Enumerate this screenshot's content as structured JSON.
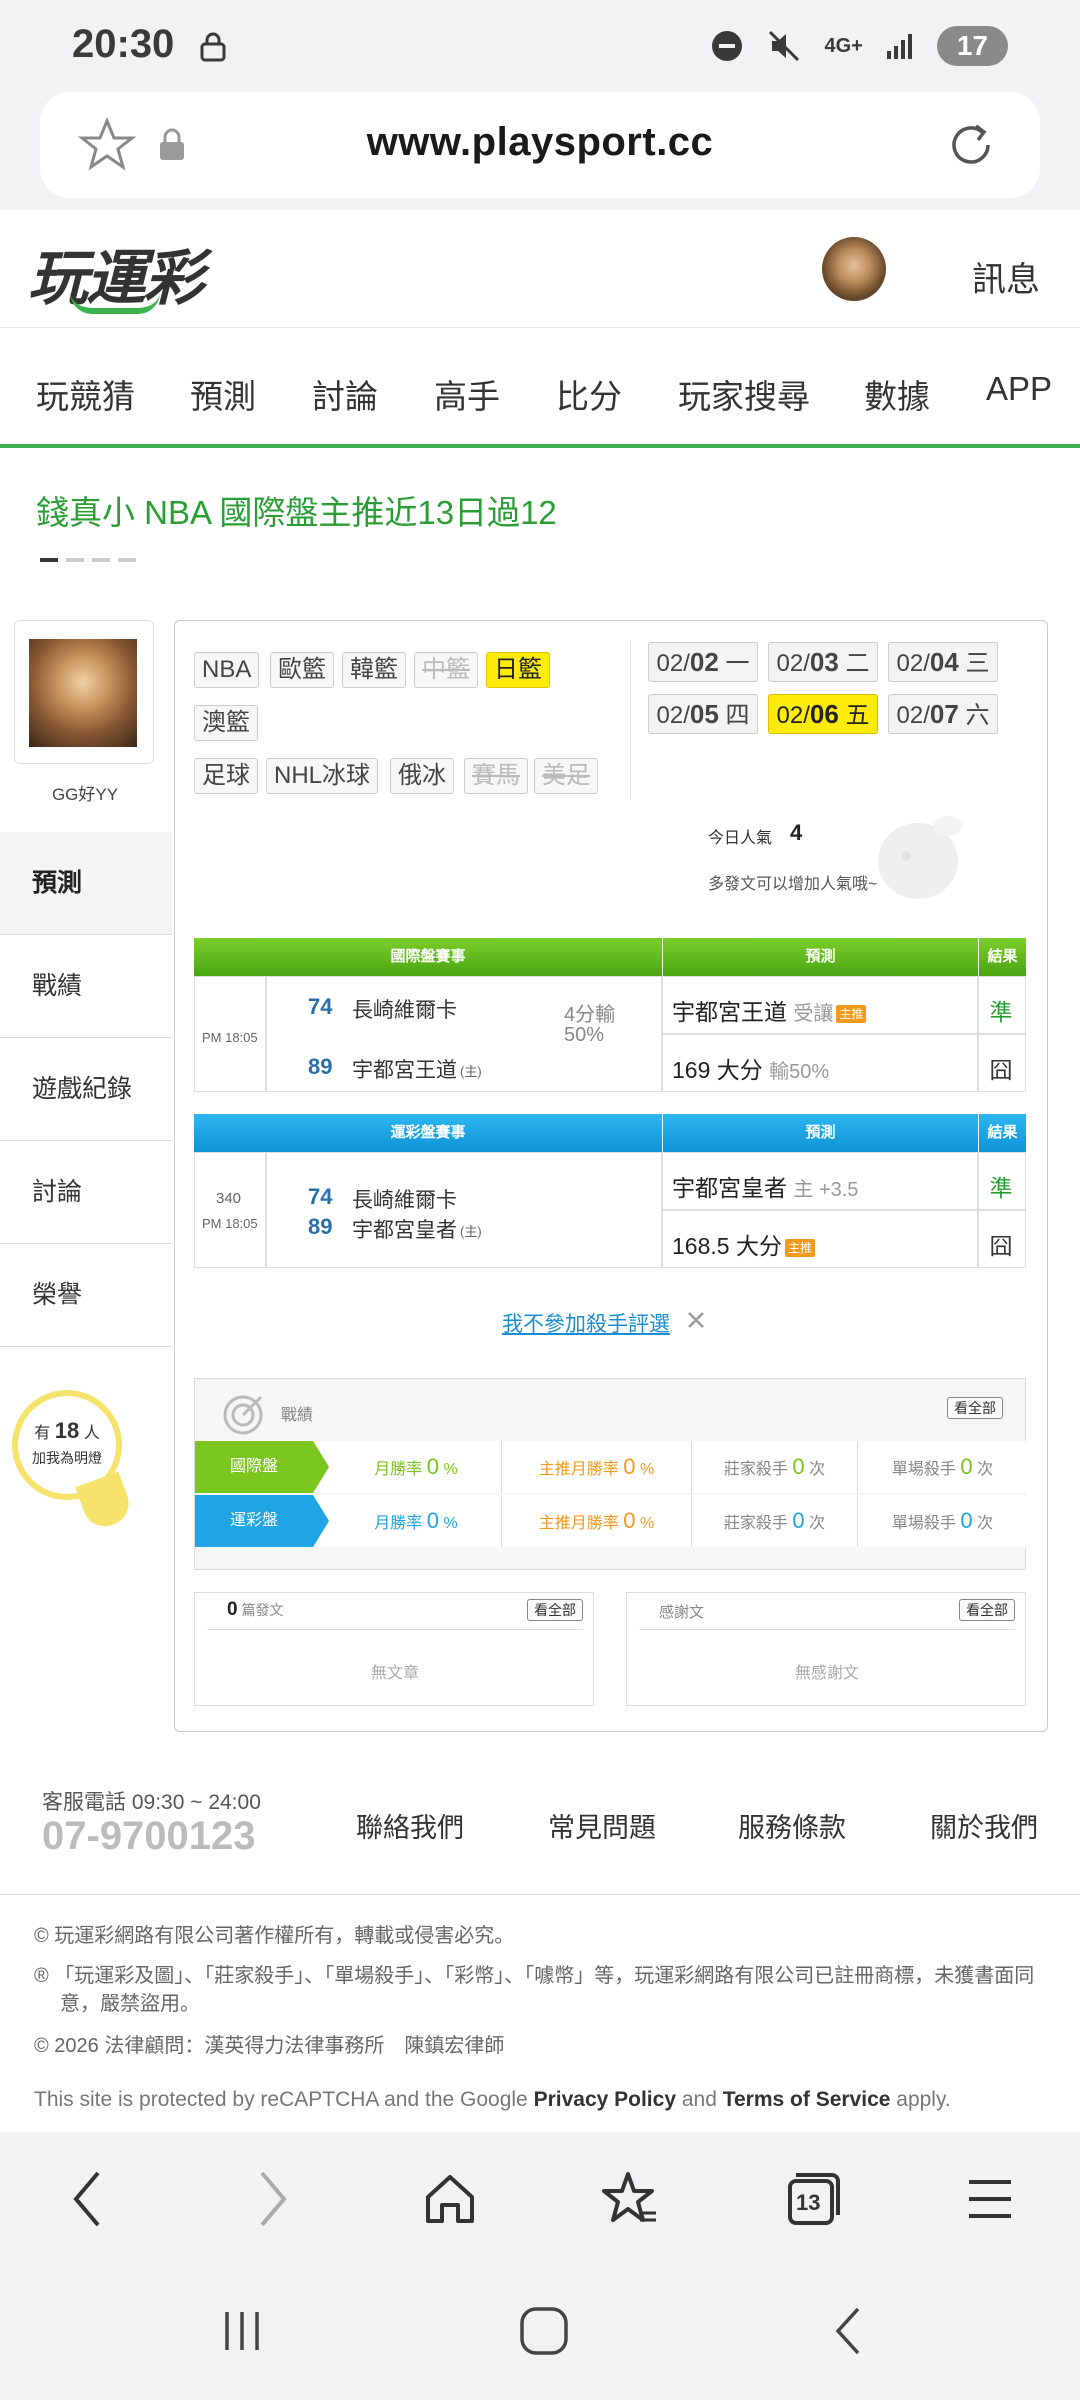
{
  "status_bar": {
    "time": "20:30",
    "network": "4G+",
    "battery": "17"
  },
  "browser": {
    "url": "www.playsport.cc",
    "tabs_count": "13"
  },
  "site": {
    "logo": "玩運彩",
    "messages_label": "訊息"
  },
  "nav": [
    "玩競猜",
    "預測",
    "討論",
    "高手",
    "比分",
    "玩家搜尋",
    "數據",
    "APP"
  ],
  "headline": "錢真小 NBA 國際盤主推近13日過12",
  "profile": {
    "name": "GG好YY"
  },
  "sidebar": [
    "預測",
    "戰績",
    "遊戲紀錄",
    "討論",
    "榮譽"
  ],
  "fans": {
    "prefix": "有",
    "count": "18",
    "suffix": "人",
    "line2": "加我為明燈"
  },
  "league_tags_row1": [
    "NBA",
    "歐籃",
    "韓籃",
    "中籃",
    "日籃"
  ],
  "league_tags_row2": [
    "澳籃"
  ],
  "league_tags_row3": [
    "足球",
    "NHL冰球",
    "俄冰",
    "賽馬",
    "美足"
  ],
  "dates": [
    {
      "md": "02/",
      "d": "02",
      "w": "一"
    },
    {
      "md": "02/",
      "d": "03",
      "w": "二"
    },
    {
      "md": "02/",
      "d": "04",
      "w": "三"
    },
    {
      "md": "02/",
      "d": "05",
      "w": "四"
    },
    {
      "md": "02/",
      "d": "06",
      "w": "五"
    },
    {
      "md": "02/",
      "d": "07",
      "w": "六"
    }
  ],
  "popularity": {
    "label": "今日人氣",
    "value": "4",
    "hint": "多發文可以增加人氣哦~"
  },
  "intl_table": {
    "head": {
      "event": "國際盤賽事",
      "pred": "預測",
      "result": "結果"
    },
    "time": "PM 18:05",
    "away_num": "74",
    "away": "長崎維爾卡",
    "home_num": "89",
    "home": "宇都宮王道",
    "home_tag": "(主)",
    "spread": "4分輸",
    "spread2": "50%",
    "pred1": "宇都宮王道",
    "pred1_note": "受讓",
    "pred1_badge": "主推",
    "pred2": "169 大分",
    "pred2_note": "輸50%",
    "res1": "準",
    "res2": "囧"
  },
  "lottery_table": {
    "head": {
      "event": "運彩盤賽事",
      "pred": "預測",
      "result": "結果"
    },
    "code": "340",
    "time": "PM 18:05",
    "away_num": "74",
    "away": "長崎維爾卡",
    "home_num": "89",
    "home": "宇都宮皇者",
    "home_tag": "(主)",
    "pred1": "宇都宮皇者",
    "pred1_note": "主 +3.5",
    "pred2": "168.5 大分",
    "pred2_badge": "主推",
    "res1": "準",
    "res2": "囧"
  },
  "opt_out": "我不參加殺手評選",
  "stats": {
    "title": "戰績",
    "view_all": "看全部",
    "rows": [
      {
        "label": "國際盤",
        "c1": "月勝率",
        "v1": "0",
        "u1": "%",
        "c2": "主推月勝率",
        "v2": "0",
        "u2": "%",
        "c3": "莊家殺手",
        "v3": "0",
        "u3": "次",
        "c4": "單場殺手",
        "v4": "0",
        "u4": "次"
      },
      {
        "label": "運彩盤",
        "c1": "月勝率",
        "v1": "0",
        "u1": "%",
        "c2": "主推月勝率",
        "v2": "0",
        "u2": "%",
        "c3": "莊家殺手",
        "v3": "0",
        "u3": "次",
        "c4": "單場殺手",
        "v4": "0",
        "u4": "次"
      }
    ]
  },
  "posts": {
    "count": "0",
    "label": "篇發文",
    "view_all": "看全部",
    "empty": "無文章"
  },
  "thanks": {
    "label": "感謝文",
    "view_all": "看全部",
    "empty": "無感謝文"
  },
  "footer": {
    "hotline_label": "客服電話 09:30 ~ 24:00",
    "phone": "07-9700123",
    "links": [
      "聯絡我們",
      "常見問題",
      "服務條款",
      "關於我們"
    ],
    "copyright": "© 玩運彩網路有限公司著作權所有，轉載或侵害必究。",
    "trademark": "® 「玩運彩及圖」、「莊家殺手」、「單場殺手」、「彩幣」、「噱幣」等，玩運彩網路有限公司已註冊商標，未獲書面同意，嚴禁盜用。",
    "legal": "© 2026 法律顧問：漢英得力法律事務所　陳鎮宏律師",
    "recaptcha_pre": "This site is protected by reCAPTCHA and the Google ",
    "privacy": "Privacy Policy",
    "and": " and ",
    "terms": "Terms of Service",
    "apply": " apply."
  },
  "colors": {
    "brand_green": "#3bb34a",
    "intl_header": "#5cb81c",
    "lottery_header": "#1fa5e3",
    "highlight": "#ffeb0a"
  }
}
